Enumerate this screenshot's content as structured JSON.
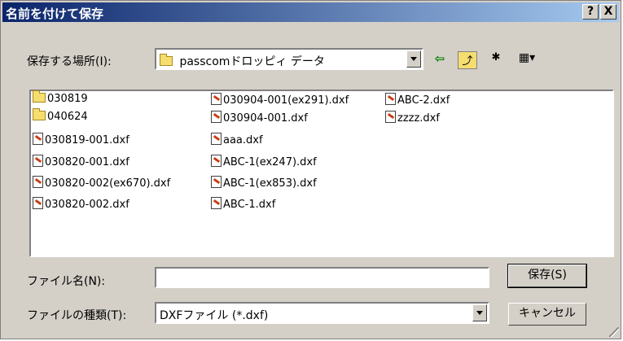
{
  "window": {
    "title": "名前を付けて保存",
    "help_label": "?",
    "close_label": "X"
  },
  "location": {
    "label": "保存する場所(I):",
    "value": "passcomドロッピィ データ"
  },
  "toolbar": {
    "back_glyph": "⇦",
    "up_glyph": "⤴",
    "new_folder_glyph": "✱",
    "view_glyph": "▦▾",
    "icons": [
      "back-arrow-icon",
      "up-folder-icon",
      "new-folder-icon",
      "view-menu-icon"
    ]
  },
  "files": {
    "col1": [
      {
        "name": "030819",
        "kind": "folder"
      },
      {
        "name": "040624",
        "kind": "folder"
      },
      {
        "name": "030819-001.dxf",
        "kind": "dxf"
      },
      {
        "name": "030820-001.dxf",
        "kind": "dxf"
      },
      {
        "name": "030820-002(ex670).dxf",
        "kind": "dxf"
      },
      {
        "name": "030820-002.dxf",
        "kind": "dxf"
      }
    ],
    "col2": [
      {
        "name": "030904-001(ex291).dxf",
        "kind": "dxf"
      },
      {
        "name": "030904-001.dxf",
        "kind": "dxf"
      },
      {
        "name": "aaa.dxf",
        "kind": "dxf"
      },
      {
        "name": "ABC-1(ex247).dxf",
        "kind": "dxf"
      },
      {
        "name": "ABC-1(ex853).dxf",
        "kind": "dxf"
      },
      {
        "name": "ABC-1.dxf",
        "kind": "dxf"
      }
    ],
    "col3": [
      {
        "name": "ABC-2.dxf",
        "kind": "dxf"
      },
      {
        "name": "zzzz.dxf",
        "kind": "dxf"
      }
    ]
  },
  "filename": {
    "label": "ファイル名(N):",
    "value": ""
  },
  "filetype": {
    "label": "ファイルの種類(T):",
    "value": "DXFファイル (*.dxf)"
  },
  "buttons": {
    "save": "保存(S)",
    "cancel": "キャンセル"
  }
}
